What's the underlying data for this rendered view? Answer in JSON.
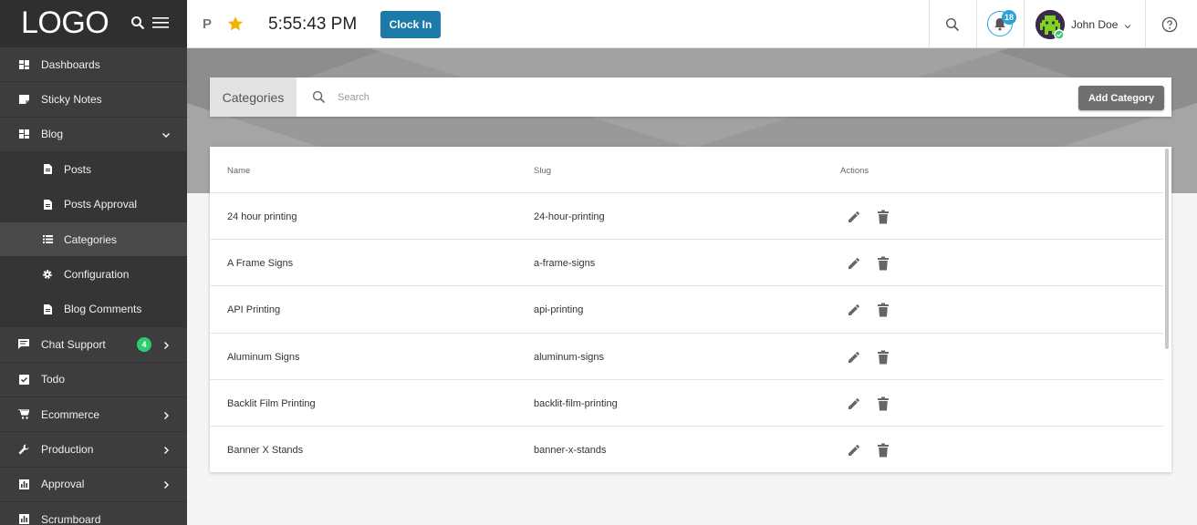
{
  "sidebar": {
    "logo": "LOGO",
    "items": [
      {
        "label": "Dashboards",
        "icon": "dashboard-icon"
      },
      {
        "label": "Sticky Notes",
        "icon": "note-icon"
      },
      {
        "label": "Blog",
        "icon": "dashboard-icon",
        "expanded": true
      },
      {
        "label": "Posts",
        "icon": "file-icon",
        "sub": true
      },
      {
        "label": "Posts Approval",
        "icon": "file-icon",
        "sub": true
      },
      {
        "label": "Categories",
        "icon": "list-icon",
        "sub": true,
        "active": true
      },
      {
        "label": "Configuration",
        "icon": "gear-icon",
        "sub": true
      },
      {
        "label": "Blog Comments",
        "icon": "file-icon",
        "sub": true
      },
      {
        "label": "Chat Support",
        "icon": "chat-icon",
        "badge": "4"
      },
      {
        "label": "Todo",
        "icon": "check-icon"
      },
      {
        "label": "Ecommerce",
        "icon": "cart-icon"
      },
      {
        "label": "Production",
        "icon": "wrench-icon"
      },
      {
        "label": "Approval",
        "icon": "chart-icon"
      },
      {
        "label": "Scrumboard",
        "icon": "chart-icon"
      }
    ]
  },
  "header": {
    "p_label": "P",
    "time": "5:55:43 PM",
    "clock_in": "Clock In",
    "notifications": "18",
    "user_name": "John Doe"
  },
  "toolbar": {
    "title": "Categories",
    "search_placeholder": "Search",
    "add_label": "Add Category"
  },
  "table": {
    "columns": [
      "Name",
      "Slug",
      "Actions"
    ],
    "rows": [
      {
        "name": "24 hour printing",
        "slug": "24-hour-printing"
      },
      {
        "name": "A Frame Signs",
        "slug": "a-frame-signs"
      },
      {
        "name": "API Printing",
        "slug": "api-printing"
      },
      {
        "name": "Aluminum Signs",
        "slug": "aluminum-signs"
      },
      {
        "name": "Backlit Film Printing",
        "slug": "backlit-film-printing"
      },
      {
        "name": "Banner X Stands",
        "slug": "banner-x-stands"
      }
    ]
  },
  "colors": {
    "sidebar": "#3d3d3d",
    "accent": "#1d7aa8",
    "badge_green": "#2ecc71",
    "star": "#f5b301"
  }
}
